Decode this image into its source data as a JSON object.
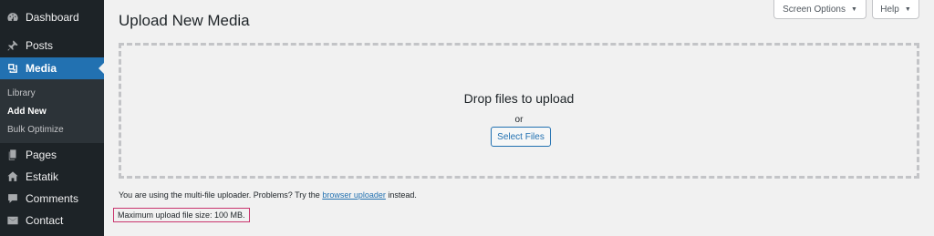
{
  "sidebar": {
    "items": [
      {
        "label": "Dashboard",
        "icon": "dashboard-icon"
      },
      {
        "label": "Posts",
        "icon": "pin-icon"
      },
      {
        "label": "Media",
        "icon": "media-icon",
        "active": true
      },
      {
        "label": "Pages",
        "icon": "pages-icon"
      },
      {
        "label": "Estatik",
        "icon": "home-icon"
      },
      {
        "label": "Comments",
        "icon": "comment-icon"
      },
      {
        "label": "Contact",
        "icon": "mail-icon"
      }
    ],
    "submenu": [
      {
        "label": "Library"
      },
      {
        "label": "Add New",
        "current": true
      },
      {
        "label": "Bulk Optimize"
      }
    ]
  },
  "header": {
    "title": "Upload New Media",
    "screen_options": "Screen Options",
    "help": "Help"
  },
  "dropzone": {
    "title": "Drop files to upload",
    "or": "or",
    "select_button": "Select Files"
  },
  "note": {
    "prefix": "You are using the multi-file uploader. Problems? Try the",
    "link": "browser uploader",
    "suffix": "instead."
  },
  "max_size": "Maximum upload file size: 100 MB.",
  "colors": {
    "sidebar_bg": "#1d2327",
    "active_bg": "#2271b1",
    "highlight_border": "#c9356e"
  }
}
